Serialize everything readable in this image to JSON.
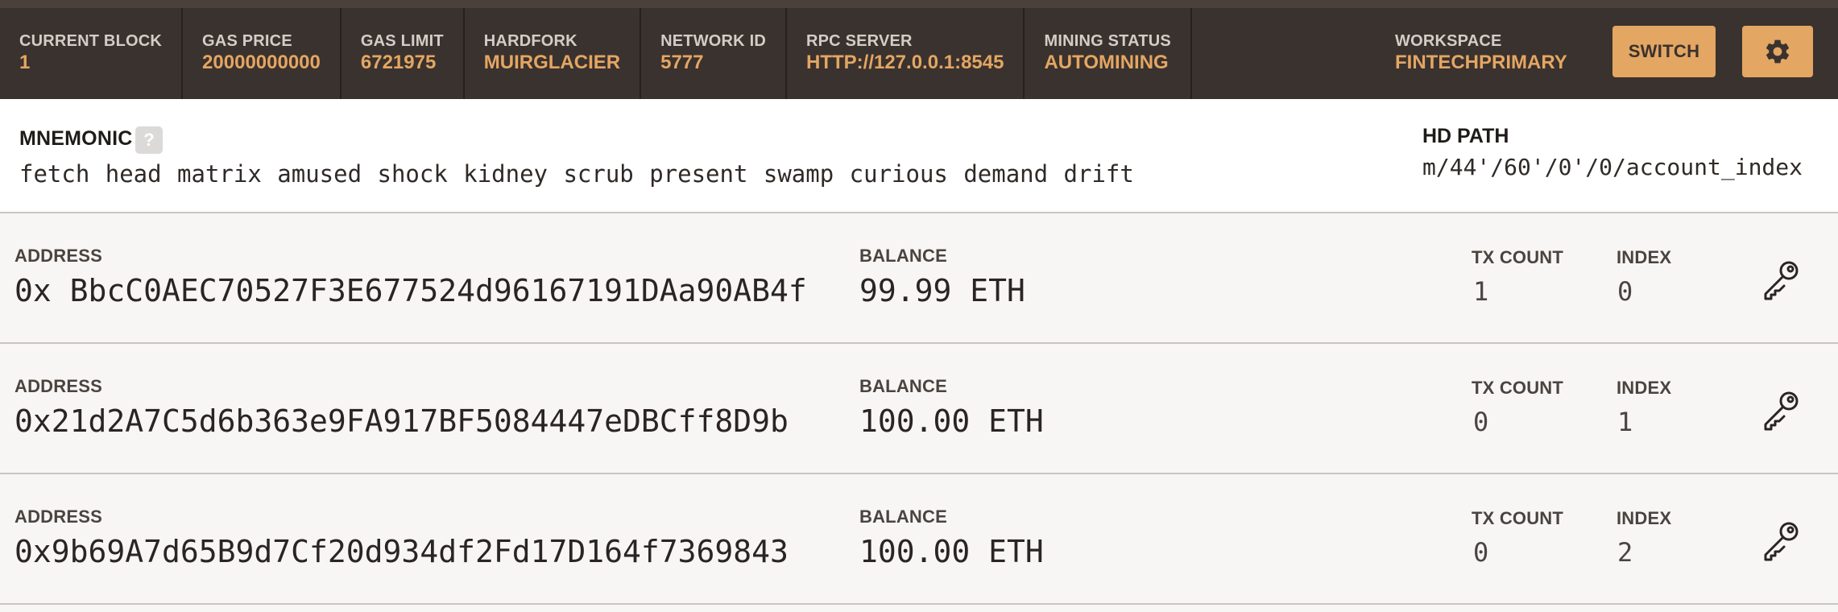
{
  "topbar": {
    "stats": [
      {
        "label": "CURRENT BLOCK",
        "value": "1"
      },
      {
        "label": "GAS PRICE",
        "value": "20000000000"
      },
      {
        "label": "GAS LIMIT",
        "value": "6721975"
      },
      {
        "label": "HARDFORK",
        "value": "MUIRGLACIER"
      },
      {
        "label": "NETWORK ID",
        "value": "5777"
      },
      {
        "label": "RPC SERVER",
        "value": "HTTP://127.0.0.1:8545"
      },
      {
        "label": "MINING STATUS",
        "value": "AUTOMINING"
      }
    ],
    "workspace": {
      "label": "WORKSPACE",
      "value": "FINTECHPRIMARY"
    },
    "switch_label": "SWITCH",
    "settings_icon": "gear-icon"
  },
  "mnemonic": {
    "label": "MNEMONIC",
    "help": "?",
    "words": "fetch head matrix amused shock kidney scrub present swamp curious demand drift",
    "hd_path_label": "HD PATH",
    "hd_path": "m/44'/60'/0'/0/account_index"
  },
  "accounts": [
    {
      "address_label": "ADDRESS",
      "address": "0x BbcC0AEC70527F3E677524d96167191DAa90AB4f",
      "balance_label": "BALANCE",
      "balance": "99.99 ETH",
      "tx_label": "TX COUNT",
      "tx_count": "1",
      "index_label": "INDEX",
      "index": "0"
    },
    {
      "address_label": "ADDRESS",
      "address": "0x21d2A7C5d6b363e9FA917BF5084447eDBCff8D9b",
      "balance_label": "BALANCE",
      "balance": "100.00 ETH",
      "tx_label": "TX COUNT",
      "tx_count": "0",
      "index_label": "INDEX",
      "index": "1"
    },
    {
      "address_label": "ADDRESS",
      "address": "0x9b69A7d65B9d7Cf20d934df2Fd17D164f7369843",
      "balance_label": "BALANCE",
      "balance": "100.00 ETH",
      "tx_label": "TX COUNT",
      "tx_count": "0",
      "index_label": "INDEX",
      "index": "2"
    }
  ],
  "colors": {
    "topbar_bg": "#3a322e",
    "accent": "#e4a663",
    "page_bg": "#f7f6f4"
  }
}
